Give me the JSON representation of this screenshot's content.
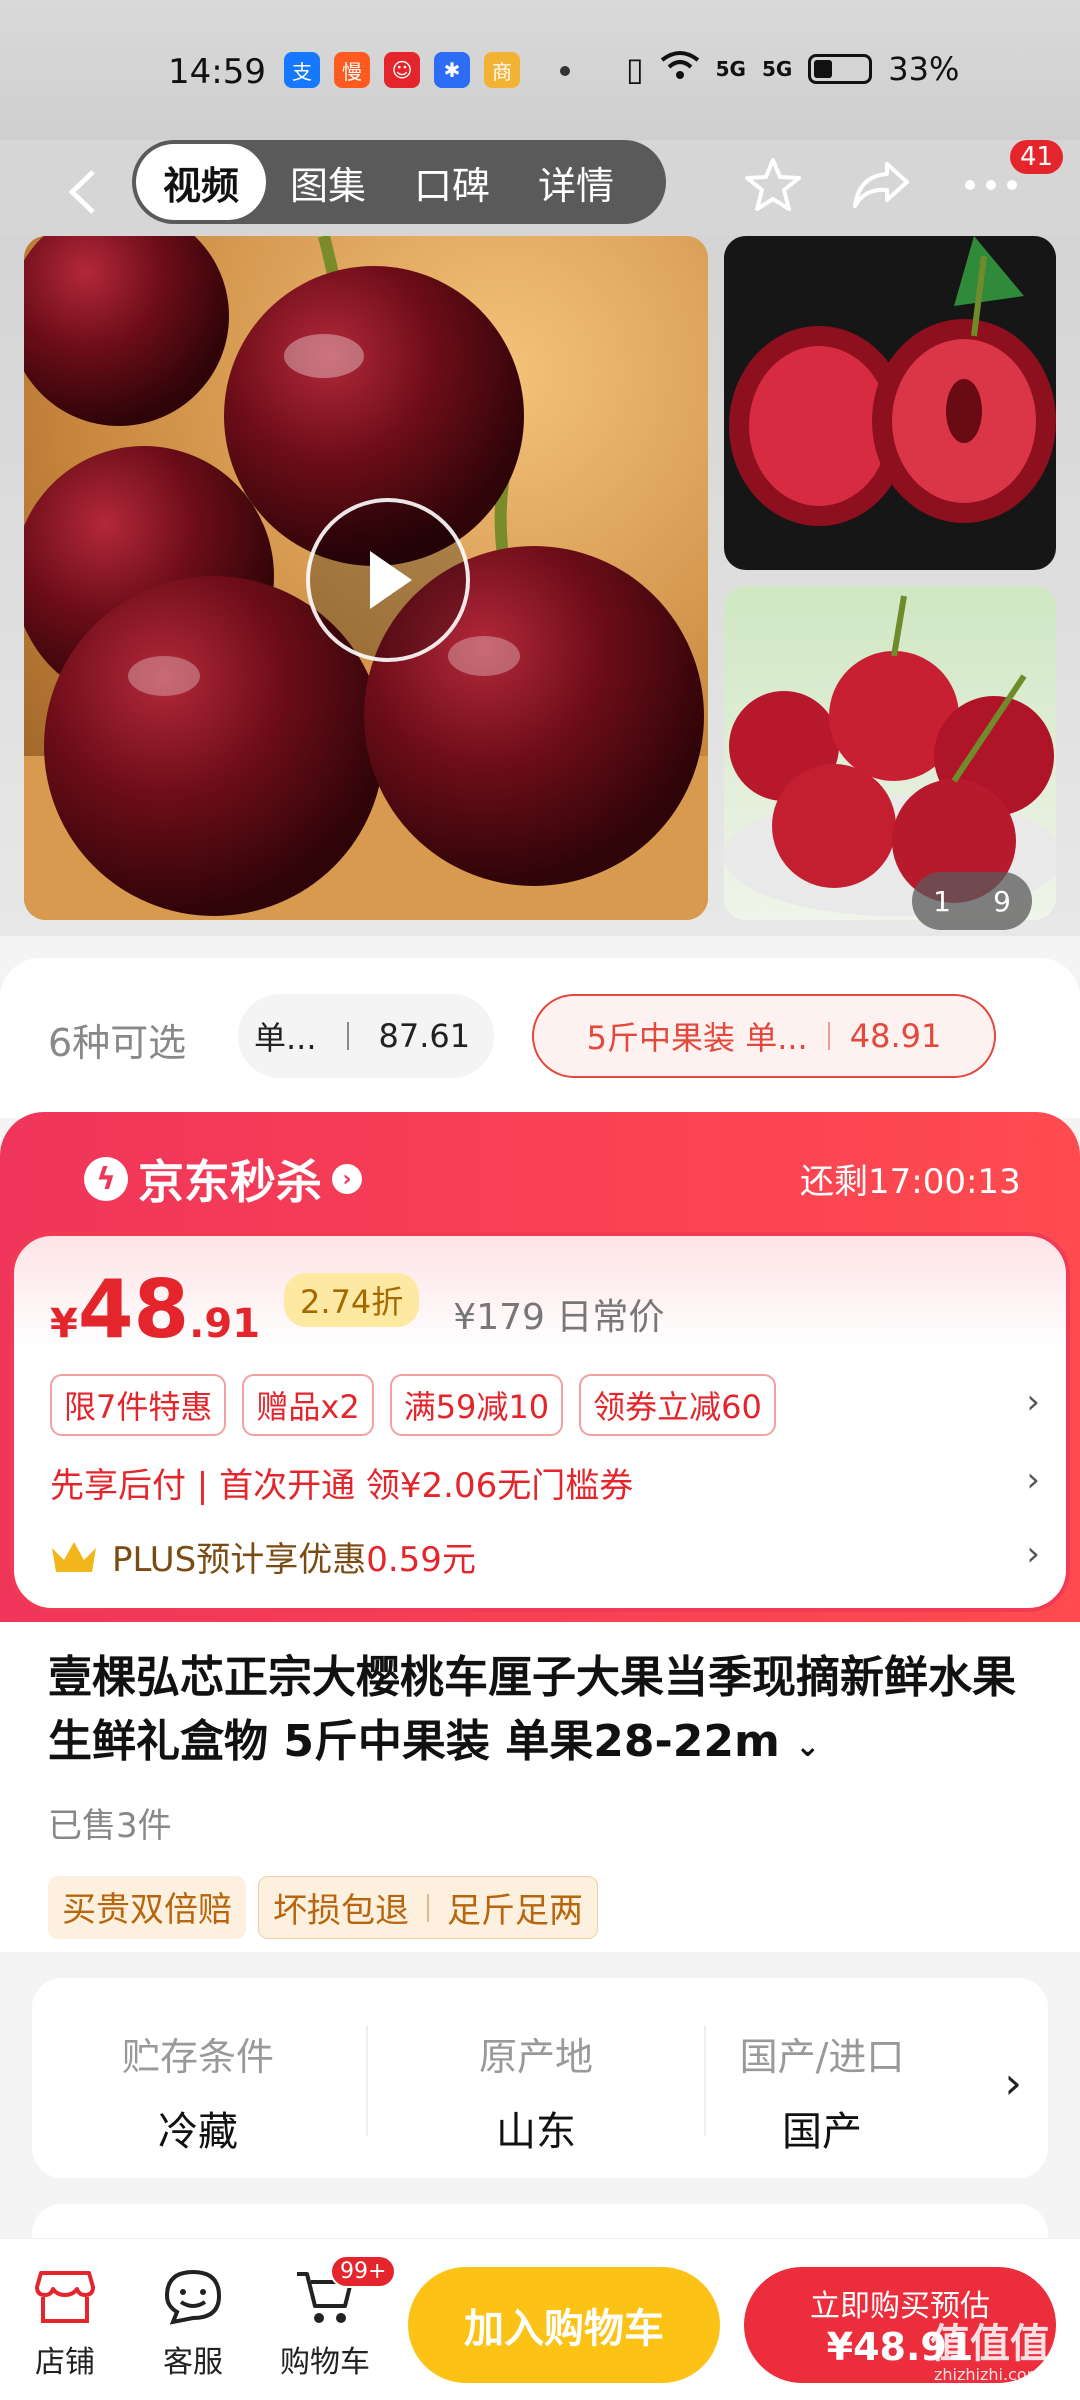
{
  "status_bar": {
    "time": "14:59",
    "apps": [
      {
        "icon": "alipay-icon",
        "glyph": "支",
        "color": "#1677ff"
      },
      {
        "icon": "app-icon",
        "glyph": "慢",
        "color": "#ff5a1f"
      },
      {
        "icon": "app-icon",
        "glyph": "☺",
        "color": "#e4262c"
      },
      {
        "icon": "baidu-icon",
        "glyph": "✱",
        "color": "#2d6cf5"
      },
      {
        "icon": "realme-icon",
        "glyph": "商",
        "color": "#f2b233"
      }
    ],
    "signal1": "5G",
    "signal2": "5G",
    "battery": "33%"
  },
  "nav": {
    "tabs": [
      "视频",
      "图集",
      "口碑",
      "详情"
    ],
    "active_tab": 0,
    "badge": "41"
  },
  "gallery": {
    "counter_current": "1",
    "counter_total": "9"
  },
  "variants": {
    "label": "6种可选",
    "option1_name": "单...",
    "option1_price": "87.61",
    "option2_name": "5斤中果装 单...",
    "option2_price": "48.91"
  },
  "flash_sale": {
    "title": "京东秒杀",
    "timer": "还剩17:00:13",
    "price_symbol": "¥",
    "price_int": "48",
    "price_dec": ".91",
    "discount": "2.74折",
    "original_price": "¥179 日常价",
    "tags": [
      "限7件特惠",
      "赠品x2",
      "满59减10",
      "领券立减60"
    ],
    "credit_text": "先享后付 | 首次开通 领¥2.06无门槛券",
    "plus_text": "PLUS预计享优惠",
    "plus_amount": "0.59元"
  },
  "product": {
    "title": "壹棵弘芯正宗大樱桃车厘子大果当季现摘新鲜水果生鲜礼盒物 5斤中果装 单果28-22m",
    "sold": "已售3件",
    "guarantee1": "买贵双倍赔",
    "guarantee2": "坏损包退",
    "guarantee3": "足斤足两"
  },
  "specs": [
    {
      "label": "贮存条件",
      "value": "冷藏"
    },
    {
      "label": "原产地",
      "value": "山东"
    },
    {
      "label": "国产/进口",
      "value": "国产"
    }
  ],
  "bottom_bar": {
    "store_label": "店铺",
    "service_label": "客服",
    "cart_label": "购物车",
    "cart_badge": "99+",
    "add_cart": "加入购物车",
    "buy_line1": "立即购买预估",
    "buy_line2": "¥48.91"
  },
  "watermark": {
    "text": "值值值",
    "sub": "zhizhizhi.com"
  },
  "colors": {
    "accent_red": "#e4262c",
    "cart_yellow": "#fcc216",
    "flash_red": "#f0355a"
  }
}
